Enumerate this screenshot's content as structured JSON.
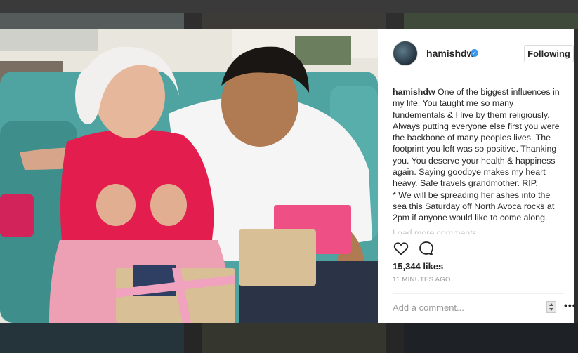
{
  "post": {
    "username": "hamishdw",
    "follow_label": "Following",
    "caption_lines": [
      "One of the biggest influences in",
      "my life. You taught me so many",
      "fundementals & I live by them religiously.",
      "Always putting everyone else first you were",
      "the backbone of many peoples lives. The",
      "footprint you left was so positive. Thanking",
      "you. You deserve your health & happiness",
      "again. Saying goodbye makes my heart",
      "heavy. Safe travels grandmother. RIP.",
      "* We will be spreading her ashes into the",
      "sea this Saturday off North Avoca rocks at",
      "2pm if anyone would like to come along."
    ],
    "load_more_label": "Load more comments",
    "likes": "15,344 likes",
    "time_ago": "11 MINUTES AGO",
    "comment_placeholder": "Add a comment...",
    "more_label": "•••"
  },
  "icons": [
    "verified-badge-icon",
    "heart-icon",
    "comment-icon",
    "options-icon"
  ],
  "colors": {
    "accent": "#3897f0",
    "text": "#262626",
    "muted": "#999999",
    "border": "#efefef"
  }
}
